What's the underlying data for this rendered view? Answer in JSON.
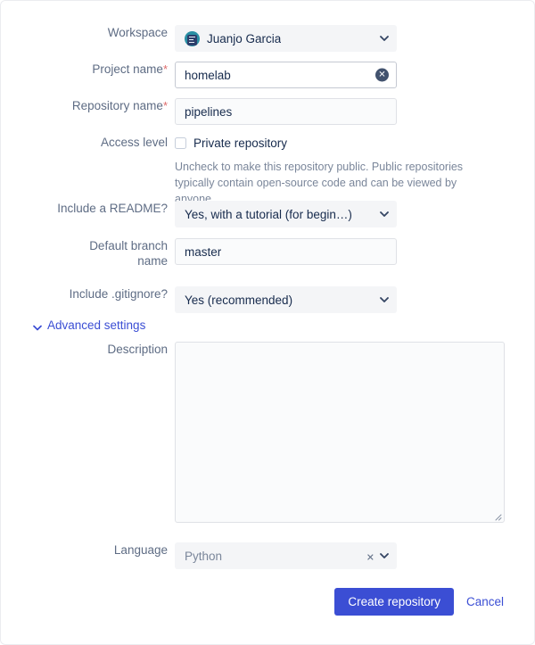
{
  "form": {
    "workspace": {
      "label": "Workspace",
      "value": "Juanjo Garcia",
      "avatar_color": "#2a8fa4"
    },
    "project_name": {
      "label": "Project name",
      "required_marker": "*",
      "value": "homelab",
      "placeholder": "",
      "clear_icon": "clear-circle-icon"
    },
    "repository_name": {
      "label": "Repository name",
      "required_marker": "*",
      "value": "pipelines",
      "placeholder": ""
    },
    "access_level": {
      "label": "Access level",
      "checkbox_label": "Private repository",
      "checked": false,
      "helper_line_1": "Uncheck to make this repository public. Public repositories",
      "helper_line_2": "typically contain open-source code and can be viewed by anyone."
    },
    "readme": {
      "label": "Include a README?",
      "value": "Yes, with a tutorial (for begin…)"
    },
    "default_branch": {
      "label_line_1": "Default branch",
      "label_line_2": "name",
      "value": "master",
      "placeholder": ""
    },
    "gitignore": {
      "label": "Include .gitignore?",
      "value": "Yes (recommended)"
    },
    "advanced_settings": {
      "label": "Advanced settings",
      "expanded": true
    },
    "description": {
      "label": "Description",
      "value": "",
      "placeholder": ""
    },
    "language": {
      "label": "Language",
      "value": "Python",
      "clear_icon": "clear-x-icon"
    }
  },
  "footer": {
    "submit_label": "Create repository",
    "cancel_label": "Cancel"
  },
  "colors": {
    "primary": "#3b4ed4",
    "label": "#5e6c84",
    "text": "#172b4d",
    "helper": "#7a869a",
    "required": "#de6b6b",
    "field_bg": "#fafbfc",
    "select_bg": "#f4f5f7"
  }
}
